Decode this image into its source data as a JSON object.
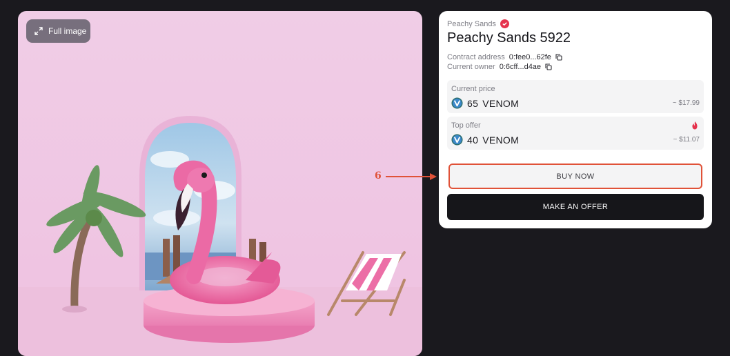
{
  "image_card": {
    "full_image_label": "Full image"
  },
  "nft": {
    "collection": "Peachy Sands",
    "title": "Peachy Sands 5922",
    "contract_label": "Contract address",
    "contract_value": "0:fee0...62fe",
    "owner_label": "Current owner",
    "owner_value": "0:6cff...d4ae"
  },
  "current_price": {
    "label": "Current price",
    "amount": "65",
    "currency": "VENOM",
    "usd": "~ $17.99"
  },
  "top_offer": {
    "label": "Top offer",
    "amount": "40",
    "currency": "VENOM",
    "usd": "~ $11.07"
  },
  "actions": {
    "buy_label": "BUY NOW",
    "offer_label": "MAKE AN OFFER"
  },
  "annotation": {
    "number": "6"
  },
  "icons": {
    "expand": "expand-icon",
    "verified": "verified-badge-icon",
    "copy": "copy-icon",
    "venom": "venom-logo-icon",
    "fire": "fire-icon"
  },
  "colors": {
    "accent": "#e05238",
    "verified": "#e5334d",
    "dark_button": "#16161a",
    "background": "#1a191e"
  }
}
